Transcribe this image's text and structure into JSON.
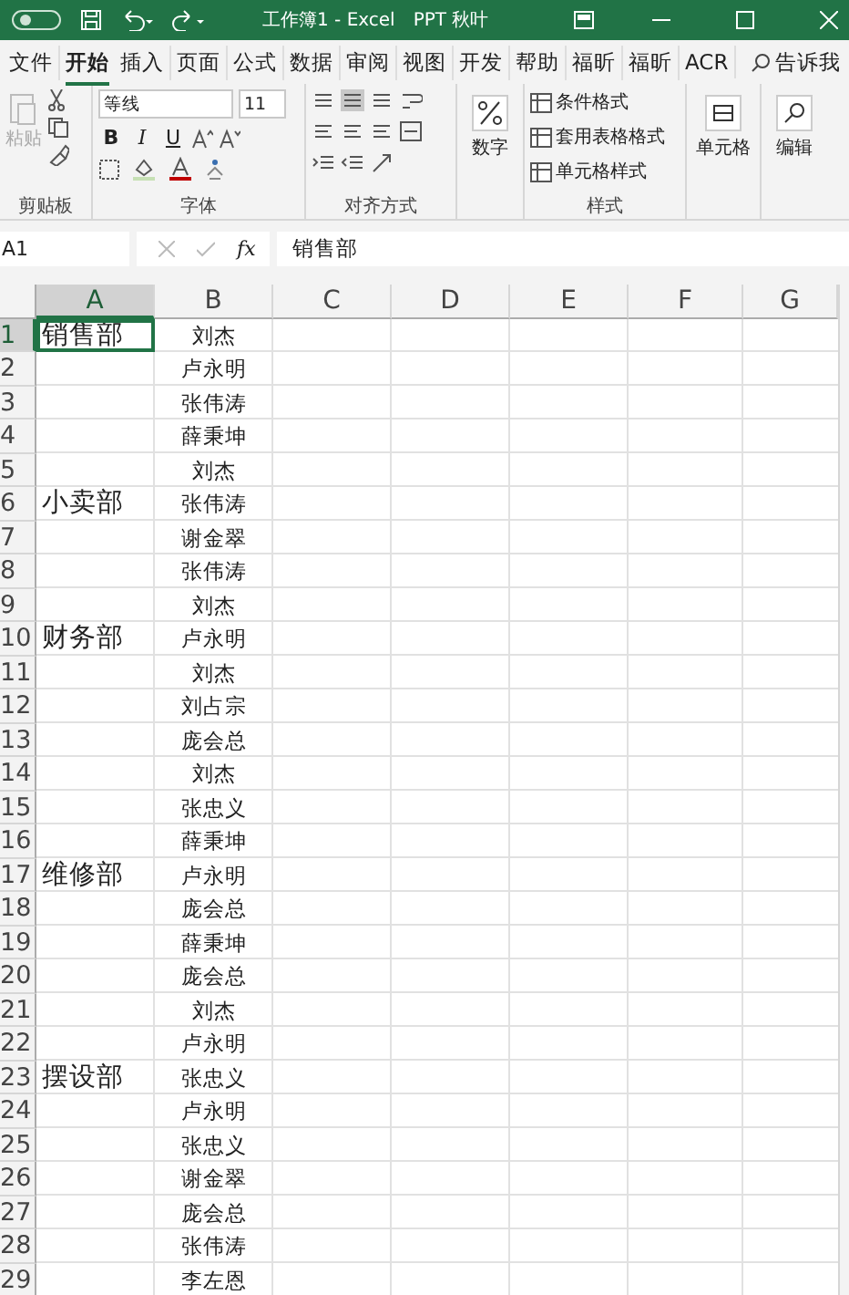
{
  "title_bar": {
    "title": "工作簿1 - Excel",
    "account": "PPT 秋叶"
  },
  "tabs": [
    {
      "label": "文件",
      "selected": false
    },
    {
      "label": "开始",
      "selected": true
    },
    {
      "label": "插入",
      "selected": false
    },
    {
      "label": "页面",
      "selected": false
    },
    {
      "label": "公式",
      "selected": false
    },
    {
      "label": "数据",
      "selected": false
    },
    {
      "label": "审阅",
      "selected": false
    },
    {
      "label": "视图",
      "selected": false
    },
    {
      "label": "开发",
      "selected": false
    },
    {
      "label": "帮助",
      "selected": false
    },
    {
      "label": "福昕",
      "selected": false
    },
    {
      "label": "福昕",
      "selected": false
    },
    {
      "label": "ACR",
      "selected": false
    }
  ],
  "tell_me": "告诉我",
  "ribbon": {
    "paste": {
      "label": "粘贴",
      "disabled": true
    },
    "font_name": "等线",
    "font_size": "11",
    "bold": "B",
    "italic": "I",
    "underline": "U",
    "number_label": "数字",
    "styles": [
      "条件格式",
      "套用表格格式",
      "单元格样式"
    ],
    "cells_label": "单元格",
    "editing_label": "编辑",
    "group_labels": [
      "剪贴板",
      "字体",
      "对齐方式",
      "样式"
    ]
  },
  "formula_bar": {
    "name_box": "A1",
    "fx": "fx",
    "formula": "销售部"
  },
  "sheet": {
    "columns": [
      {
        "label": "A",
        "selected": true
      },
      {
        "label": "B",
        "selected": false
      },
      {
        "label": "C",
        "selected": false
      },
      {
        "label": "D",
        "selected": false
      },
      {
        "label": "E",
        "selected": false
      },
      {
        "label": "F",
        "selected": false
      },
      {
        "label": "G",
        "selected": false
      }
    ],
    "rows": [
      {
        "number": "1",
        "a": "销售部",
        "b": "刘杰",
        "selected": true
      },
      {
        "number": "2",
        "b": "卢永明",
        "selected": false
      },
      {
        "number": "3",
        "b": "张伟涛",
        "selected": false
      },
      {
        "number": "4",
        "b": "薛秉坤",
        "selected": false
      },
      {
        "number": "5",
        "b": "刘杰",
        "selected": false
      },
      {
        "number": "6",
        "a": "小卖部",
        "b": "张伟涛",
        "selected": false
      },
      {
        "number": "7",
        "b": "谢金翠",
        "selected": false
      },
      {
        "number": "8",
        "b": "张伟涛",
        "selected": false
      },
      {
        "number": "9",
        "b": "刘杰",
        "selected": false
      },
      {
        "number": "10",
        "a": "财务部",
        "b": "卢永明",
        "selected": false
      },
      {
        "number": "11",
        "b": "刘杰",
        "selected": false
      },
      {
        "number": "12",
        "b": "刘占宗",
        "selected": false
      },
      {
        "number": "13",
        "b": "庞会总",
        "selected": false
      },
      {
        "number": "14",
        "b": "刘杰",
        "selected": false
      },
      {
        "number": "15",
        "b": "张忠义",
        "selected": false
      },
      {
        "number": "16",
        "b": "薛秉坤",
        "selected": false
      },
      {
        "number": "17",
        "a": "维修部",
        "b": "卢永明",
        "selected": false
      },
      {
        "number": "18",
        "b": "庞会总",
        "selected": false
      },
      {
        "number": "19",
        "b": "薛秉坤",
        "selected": false
      },
      {
        "number": "20",
        "b": "庞会总",
        "selected": false
      },
      {
        "number": "21",
        "b": "刘杰",
        "selected": false
      },
      {
        "number": "22",
        "b": "卢永明",
        "selected": false
      },
      {
        "number": "23",
        "a": "摆设部",
        "b": "张忠义",
        "selected": false
      },
      {
        "number": "24",
        "b": "卢永明",
        "selected": false
      },
      {
        "number": "25",
        "b": "张忠义",
        "selected": false
      },
      {
        "number": "26",
        "b": "谢金翠",
        "selected": false
      },
      {
        "number": "27",
        "b": "庞会总",
        "selected": false
      },
      {
        "number": "28",
        "b": "张伟涛",
        "selected": false
      },
      {
        "number": "29",
        "b": "李左恩",
        "selected": false
      }
    ]
  }
}
